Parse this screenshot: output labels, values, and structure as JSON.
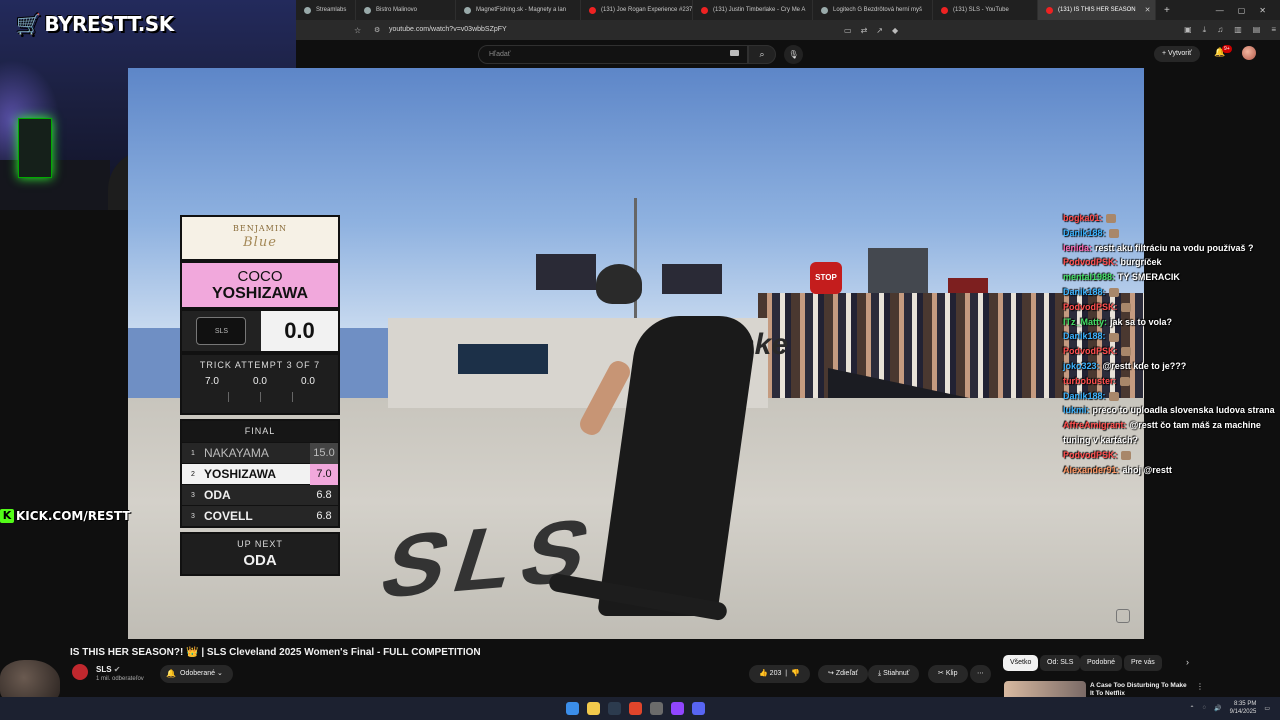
{
  "browser": {
    "tabs": [
      {
        "label": "Streamlabs",
        "icon": "globe-icon"
      },
      {
        "label": "Bistro Malinovo",
        "icon": "globe-icon"
      },
      {
        "label": "MagnetFishing.sk - Magnety a lan",
        "icon": "globe-icon"
      },
      {
        "label": "(131) Joe Rogan Experience #237",
        "icon": "youtube-icon"
      },
      {
        "label": "(131) Justin Timberlake - Cry Me A",
        "icon": "youtube-icon"
      },
      {
        "label": "Logitech G Bezdrôtová herní myš",
        "icon": "globe-icon"
      },
      {
        "label": "(131) SLS - YouTube",
        "icon": "youtube-icon"
      },
      {
        "label": "(131) IS THIS HER SEASON",
        "icon": "youtube-icon",
        "active": true
      }
    ],
    "url": "youtube.com/watch?v=v03wbbSZpFY"
  },
  "youtube": {
    "search_placeholder": "Hľadať",
    "create_label": "Vytvoriť",
    "notif_count": "9+",
    "video_title": "IS THIS HER SEASON?! 👑 | SLS Cleveland 2025 Women's Final - FULL COMPETITION",
    "channel": "SLS",
    "subscribers": "1 mil. odberateľov",
    "subscribed_label": "Odoberané",
    "likes": "203",
    "share_label": "Zdieľať",
    "download_label": "Stiahnuť",
    "clip_label": "Klip",
    "chips": [
      "Všetko",
      "Od: SLS",
      "Podobné",
      "Pre vás"
    ],
    "rec_title": "A Case Too Disturbing To Make It To Netflix"
  },
  "stream": {
    "logo": "BYRESTT.SK",
    "kick": "KICK.COM/RESTT"
  },
  "scoreboard": {
    "sponsor_top": "BENJAMIN",
    "sponsor_script": "Blue",
    "first_name": "COCO",
    "last_name": "YOSHIZAWA",
    "badge": "SLS",
    "current_score": "0.0",
    "attempt_title": "TRICK ATTEMPT 3 OF 7",
    "attempts": [
      "7.0",
      "0.0",
      "0.0"
    ],
    "final_title": "FINAL",
    "standings": [
      {
        "rank": "1",
        "name": "NAKAYAMA",
        "score": "15.0",
        "style": "dim"
      },
      {
        "rank": "2",
        "name": "YOSHIZAWA",
        "score": "7.0",
        "style": "hl"
      },
      {
        "rank": "3",
        "name": "ODA",
        "score": "6.8",
        "style": ""
      },
      {
        "rank": "3",
        "name": "COVELL",
        "score": "6.8",
        "style": ""
      }
    ],
    "up_next_title": "UP NEXT",
    "up_next": "ODA"
  },
  "video_scene": {
    "stop_sign": "STOP",
    "ramp_sign": "Stake",
    "ground_text": "SLS"
  },
  "chat": [
    {
      "user": "bogka01",
      "text": "",
      "color": "#ff4d4d"
    },
    {
      "user": "Danik188",
      "text": "",
      "color": "#3bb3ff"
    },
    {
      "user": "lenida",
      "text": "restt aku filtráciu na vodu používaš ?",
      "color": "#ff69b4"
    },
    {
      "user": "PodvodPSK",
      "text": "burgríček",
      "color": "#ff4d4d"
    },
    {
      "user": "mental1988",
      "text": "TY SMERACIK",
      "color": "#44e066"
    },
    {
      "user": "Danik188",
      "text": "",
      "color": "#3bb3ff"
    },
    {
      "user": "PodvodPSK",
      "text": "",
      "color": "#ff4d4d"
    },
    {
      "user": "ITz_Matty",
      "text": "jak sa to vola?",
      "color": "#44e066"
    },
    {
      "user": "Danik188",
      "text": "",
      "color": "#3bb3ff"
    },
    {
      "user": "PodvodPSK",
      "text": "",
      "color": "#ff4d4d"
    },
    {
      "user": "joko323",
      "text": "@restt kde to je???",
      "color": "#3bb3ff"
    },
    {
      "user": "turbobuster",
      "text": "",
      "color": "#ff4d4d"
    },
    {
      "user": "Danik188",
      "text": "",
      "color": "#3bb3ff"
    },
    {
      "user": "lukmi",
      "text": "preco to uploadla slovenska ludova strana",
      "color": "#3bb3ff"
    },
    {
      "user": "AffreAmigrant",
      "text": "@restt čo tam máš za machine tuning v kartách?",
      "color": "#ff4d4d"
    },
    {
      "user": "PodvodPSK",
      "text": "",
      "color": "#ff4d4d"
    },
    {
      "user": "Alexander91",
      "text": "ahoj @restt",
      "color": "#ff9966"
    }
  ],
  "taskbar": {
    "time": "8:35 PM",
    "date": "9/14/2025"
  }
}
